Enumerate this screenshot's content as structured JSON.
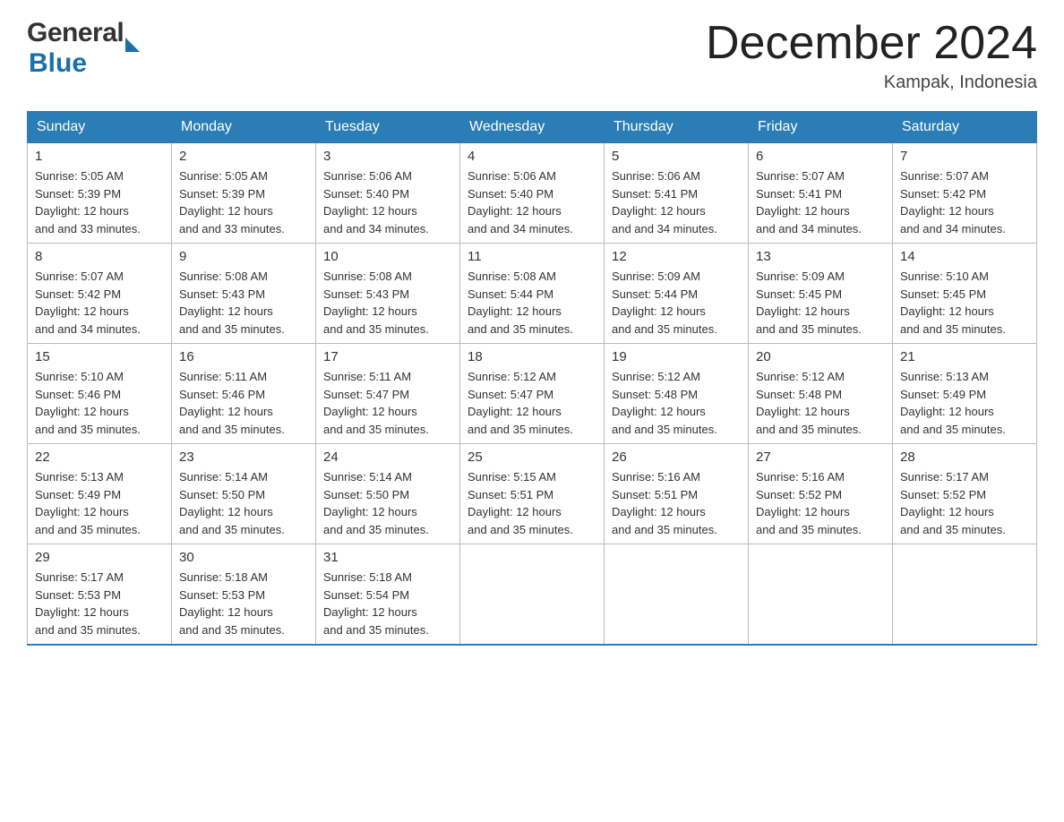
{
  "header": {
    "logo_general": "General",
    "logo_blue": "Blue",
    "month_title": "December 2024",
    "location": "Kampak, Indonesia"
  },
  "calendar": {
    "days_of_week": [
      "Sunday",
      "Monday",
      "Tuesday",
      "Wednesday",
      "Thursday",
      "Friday",
      "Saturday"
    ],
    "weeks": [
      [
        {
          "day": "1",
          "sunrise": "5:05 AM",
          "sunset": "5:39 PM",
          "daylight": "12 hours and 33 minutes."
        },
        {
          "day": "2",
          "sunrise": "5:05 AM",
          "sunset": "5:39 PM",
          "daylight": "12 hours and 33 minutes."
        },
        {
          "day": "3",
          "sunrise": "5:06 AM",
          "sunset": "5:40 PM",
          "daylight": "12 hours and 34 minutes."
        },
        {
          "day": "4",
          "sunrise": "5:06 AM",
          "sunset": "5:40 PM",
          "daylight": "12 hours and 34 minutes."
        },
        {
          "day": "5",
          "sunrise": "5:06 AM",
          "sunset": "5:41 PM",
          "daylight": "12 hours and 34 minutes."
        },
        {
          "day": "6",
          "sunrise": "5:07 AM",
          "sunset": "5:41 PM",
          "daylight": "12 hours and 34 minutes."
        },
        {
          "day": "7",
          "sunrise": "5:07 AM",
          "sunset": "5:42 PM",
          "daylight": "12 hours and 34 minutes."
        }
      ],
      [
        {
          "day": "8",
          "sunrise": "5:07 AM",
          "sunset": "5:42 PM",
          "daylight": "12 hours and 34 minutes."
        },
        {
          "day": "9",
          "sunrise": "5:08 AM",
          "sunset": "5:43 PM",
          "daylight": "12 hours and 35 minutes."
        },
        {
          "day": "10",
          "sunrise": "5:08 AM",
          "sunset": "5:43 PM",
          "daylight": "12 hours and 35 minutes."
        },
        {
          "day": "11",
          "sunrise": "5:08 AM",
          "sunset": "5:44 PM",
          "daylight": "12 hours and 35 minutes."
        },
        {
          "day": "12",
          "sunrise": "5:09 AM",
          "sunset": "5:44 PM",
          "daylight": "12 hours and 35 minutes."
        },
        {
          "day": "13",
          "sunrise": "5:09 AM",
          "sunset": "5:45 PM",
          "daylight": "12 hours and 35 minutes."
        },
        {
          "day": "14",
          "sunrise": "5:10 AM",
          "sunset": "5:45 PM",
          "daylight": "12 hours and 35 minutes."
        }
      ],
      [
        {
          "day": "15",
          "sunrise": "5:10 AM",
          "sunset": "5:46 PM",
          "daylight": "12 hours and 35 minutes."
        },
        {
          "day": "16",
          "sunrise": "5:11 AM",
          "sunset": "5:46 PM",
          "daylight": "12 hours and 35 minutes."
        },
        {
          "day": "17",
          "sunrise": "5:11 AM",
          "sunset": "5:47 PM",
          "daylight": "12 hours and 35 minutes."
        },
        {
          "day": "18",
          "sunrise": "5:12 AM",
          "sunset": "5:47 PM",
          "daylight": "12 hours and 35 minutes."
        },
        {
          "day": "19",
          "sunrise": "5:12 AM",
          "sunset": "5:48 PM",
          "daylight": "12 hours and 35 minutes."
        },
        {
          "day": "20",
          "sunrise": "5:12 AM",
          "sunset": "5:48 PM",
          "daylight": "12 hours and 35 minutes."
        },
        {
          "day": "21",
          "sunrise": "5:13 AM",
          "sunset": "5:49 PM",
          "daylight": "12 hours and 35 minutes."
        }
      ],
      [
        {
          "day": "22",
          "sunrise": "5:13 AM",
          "sunset": "5:49 PM",
          "daylight": "12 hours and 35 minutes."
        },
        {
          "day": "23",
          "sunrise": "5:14 AM",
          "sunset": "5:50 PM",
          "daylight": "12 hours and 35 minutes."
        },
        {
          "day": "24",
          "sunrise": "5:14 AM",
          "sunset": "5:50 PM",
          "daylight": "12 hours and 35 minutes."
        },
        {
          "day": "25",
          "sunrise": "5:15 AM",
          "sunset": "5:51 PM",
          "daylight": "12 hours and 35 minutes."
        },
        {
          "day": "26",
          "sunrise": "5:16 AM",
          "sunset": "5:51 PM",
          "daylight": "12 hours and 35 minutes."
        },
        {
          "day": "27",
          "sunrise": "5:16 AM",
          "sunset": "5:52 PM",
          "daylight": "12 hours and 35 minutes."
        },
        {
          "day": "28",
          "sunrise": "5:17 AM",
          "sunset": "5:52 PM",
          "daylight": "12 hours and 35 minutes."
        }
      ],
      [
        {
          "day": "29",
          "sunrise": "5:17 AM",
          "sunset": "5:53 PM",
          "daylight": "12 hours and 35 minutes."
        },
        {
          "day": "30",
          "sunrise": "5:18 AM",
          "sunset": "5:53 PM",
          "daylight": "12 hours and 35 minutes."
        },
        {
          "day": "31",
          "sunrise": "5:18 AM",
          "sunset": "5:54 PM",
          "daylight": "12 hours and 35 minutes."
        },
        null,
        null,
        null,
        null
      ]
    ],
    "sunrise_label": "Sunrise:",
    "sunset_label": "Sunset:",
    "daylight_label": "Daylight:"
  }
}
